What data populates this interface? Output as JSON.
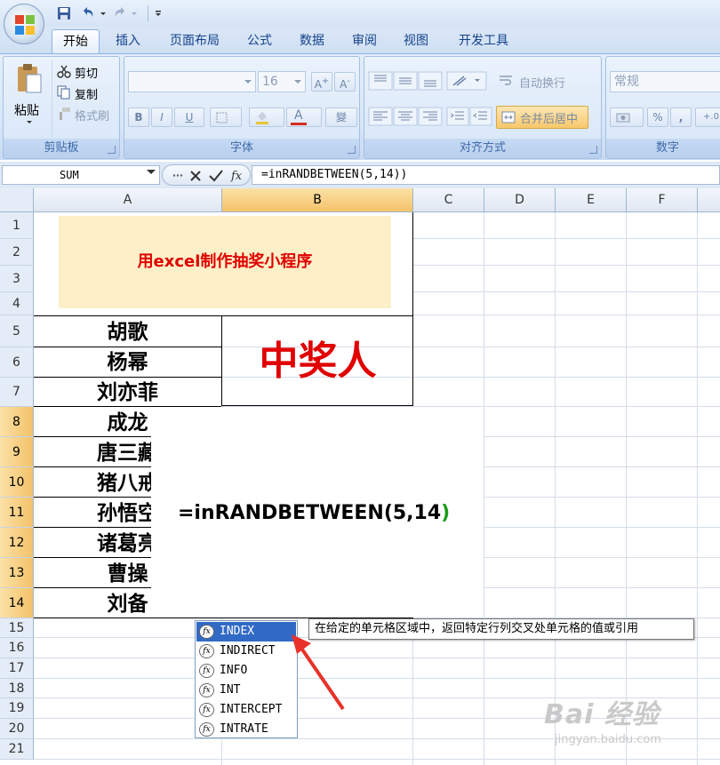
{
  "quick_access": {
    "save_icon": "save-icon",
    "undo_icon": "undo-icon",
    "redo_icon": "redo-icon",
    "customize_icon": "customize-icon"
  },
  "tabs": [
    {
      "label": "开始",
      "active": true
    },
    {
      "label": "插入"
    },
    {
      "label": "页面布局"
    },
    {
      "label": "公式"
    },
    {
      "label": "数据"
    },
    {
      "label": "审阅"
    },
    {
      "label": "视图"
    },
    {
      "label": "开发工具"
    }
  ],
  "ribbon": {
    "clipboard": {
      "paste": "粘贴",
      "cut": "剪切",
      "copy": "复制",
      "format_painter": "格式刷",
      "label": "剪贴板"
    },
    "font": {
      "font_name": "",
      "font_size": "16",
      "bold": "B",
      "italic": "I",
      "underline": "U",
      "phonetic": "變",
      "label": "字体"
    },
    "alignment": {
      "wrap_text": "自动换行",
      "merge_center": "合并后居中",
      "label": "对齐方式"
    },
    "number": {
      "format": "常规",
      "percent": "%",
      "comma": ",",
      "label": "数字"
    }
  },
  "formula_bar": {
    "name_box": "SUM",
    "formula": "=inRANDBETWEEN(5,14))"
  },
  "columns": [
    "A",
    "B",
    "C",
    "D",
    "E",
    "F"
  ],
  "rows": [
    "1",
    "2",
    "3",
    "4",
    "5",
    "6",
    "7",
    "8",
    "9",
    "10",
    "11",
    "12",
    "13",
    "14",
    "15",
    "16",
    "17",
    "18",
    "19",
    "20",
    "21"
  ],
  "sheet": {
    "title": "用excel制作抽奖小程序",
    "winner_label": "中奖人",
    "names": [
      "胡歌",
      "杨幂",
      "刘亦菲",
      "成龙",
      "唐三藏",
      "猪八戒",
      "孙悟空",
      "诸葛亮",
      "曹操",
      "刘备"
    ],
    "editing_formula": "=inRANDBETWEEN(5,14",
    "editing_formula_close": ")"
  },
  "autocomplete": {
    "items": [
      "INDEX",
      "INDIRECT",
      "INFO",
      "INT",
      "INTERCEPT",
      "INTRATE"
    ],
    "selected": "INDEX",
    "tooltip": "在给定的单元格区域中，返回特定行列交叉处单元格的值或引用"
  },
  "watermark": {
    "main": "Bai 经验",
    "sub": "jingyan.baidu.com"
  }
}
